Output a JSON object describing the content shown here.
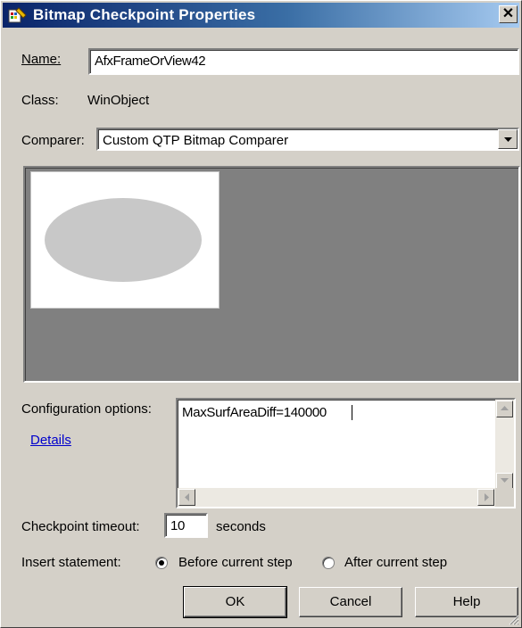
{
  "window": {
    "title": "Bitmap Checkpoint Properties",
    "close_glyph": "✕"
  },
  "name_field": {
    "label": "Name:",
    "value": "AfxFrameOrView42"
  },
  "class_field": {
    "label": "Class:",
    "value": "WinObject"
  },
  "comparer": {
    "label": "Comparer:",
    "selected": "Custom QTP Bitmap Comparer"
  },
  "config": {
    "label": "Configuration options:",
    "value": "MaxSurfAreaDiff=140000",
    "details_link": "Details"
  },
  "timeout": {
    "label": "Checkpoint timeout:",
    "value": "10",
    "unit": "seconds"
  },
  "insert": {
    "label": "Insert statement:",
    "options": [
      {
        "label": "Before current step",
        "selected": true
      },
      {
        "label": "After current step",
        "selected": false
      }
    ]
  },
  "buttons": {
    "ok": "OK",
    "cancel": "Cancel",
    "help": "Help"
  },
  "colors": {
    "title_start": "#0a246a",
    "title_end": "#a6caf0",
    "face": "#d4d0c8",
    "preview_bg": "#808080",
    "ellipse": "#c8c8c8"
  }
}
